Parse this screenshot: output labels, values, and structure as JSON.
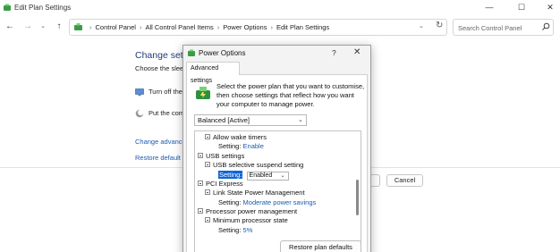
{
  "window": {
    "title": "Edit Plan Settings",
    "controls": {
      "minimize": "—",
      "maximize": "☐",
      "close": "✕"
    }
  },
  "nav": {
    "back": "←",
    "forward": "→",
    "dropdown": "⌄",
    "up": "↑",
    "breadcrumbs": [
      "Control Panel",
      "All Control Panel Items",
      "Power Options",
      "Edit Plan Settings"
    ],
    "breadcrumb_separator": "›",
    "address_chevron": "⌄",
    "refresh": "↻"
  },
  "search": {
    "placeholder": "Search Control Panel"
  },
  "main": {
    "heading": "Change setti",
    "subtext": "Choose the sleep",
    "rows": [
      "Turn off the",
      "Put the comp"
    ],
    "links": [
      "Change advanced",
      "Restore default se"
    ],
    "cancel_label": "Cancel"
  },
  "dialog": {
    "title": "Power Options",
    "help": "?",
    "close": "✕",
    "tab_label": "Advanced settings",
    "description": "Select the power plan that you want to customise, then choose settings that reflect how you want your computer to manage power.",
    "plan_select": "Balanced [Active]",
    "tree": {
      "allow_wake_timers": "Allow wake timers",
      "allow_wake_setting_label": "Setting:",
      "allow_wake_setting_value": "Enable",
      "usb_settings": "USB settings",
      "usb_selective": "USB selective suspend setting",
      "usb_setting_label": "Setting:",
      "usb_setting_value": "Enabled",
      "pci_express": "PCI Express",
      "link_state": "Link State Power Management",
      "link_setting_label": "Setting:",
      "link_setting_value": "Moderate power savings",
      "processor_pm": "Processor power management",
      "min_processor": "Minimum processor state",
      "min_setting_label": "Setting:",
      "min_setting_value": "5%"
    },
    "restore_label": "Restore plan defaults"
  },
  "icons": {
    "app": "power-options-icon",
    "search": "search-icon",
    "dialog_big": "power-plan-icon"
  },
  "colors": {
    "link": "#1c5ab0",
    "heading": "#1f3c7a",
    "selection": "#0a64d8"
  }
}
